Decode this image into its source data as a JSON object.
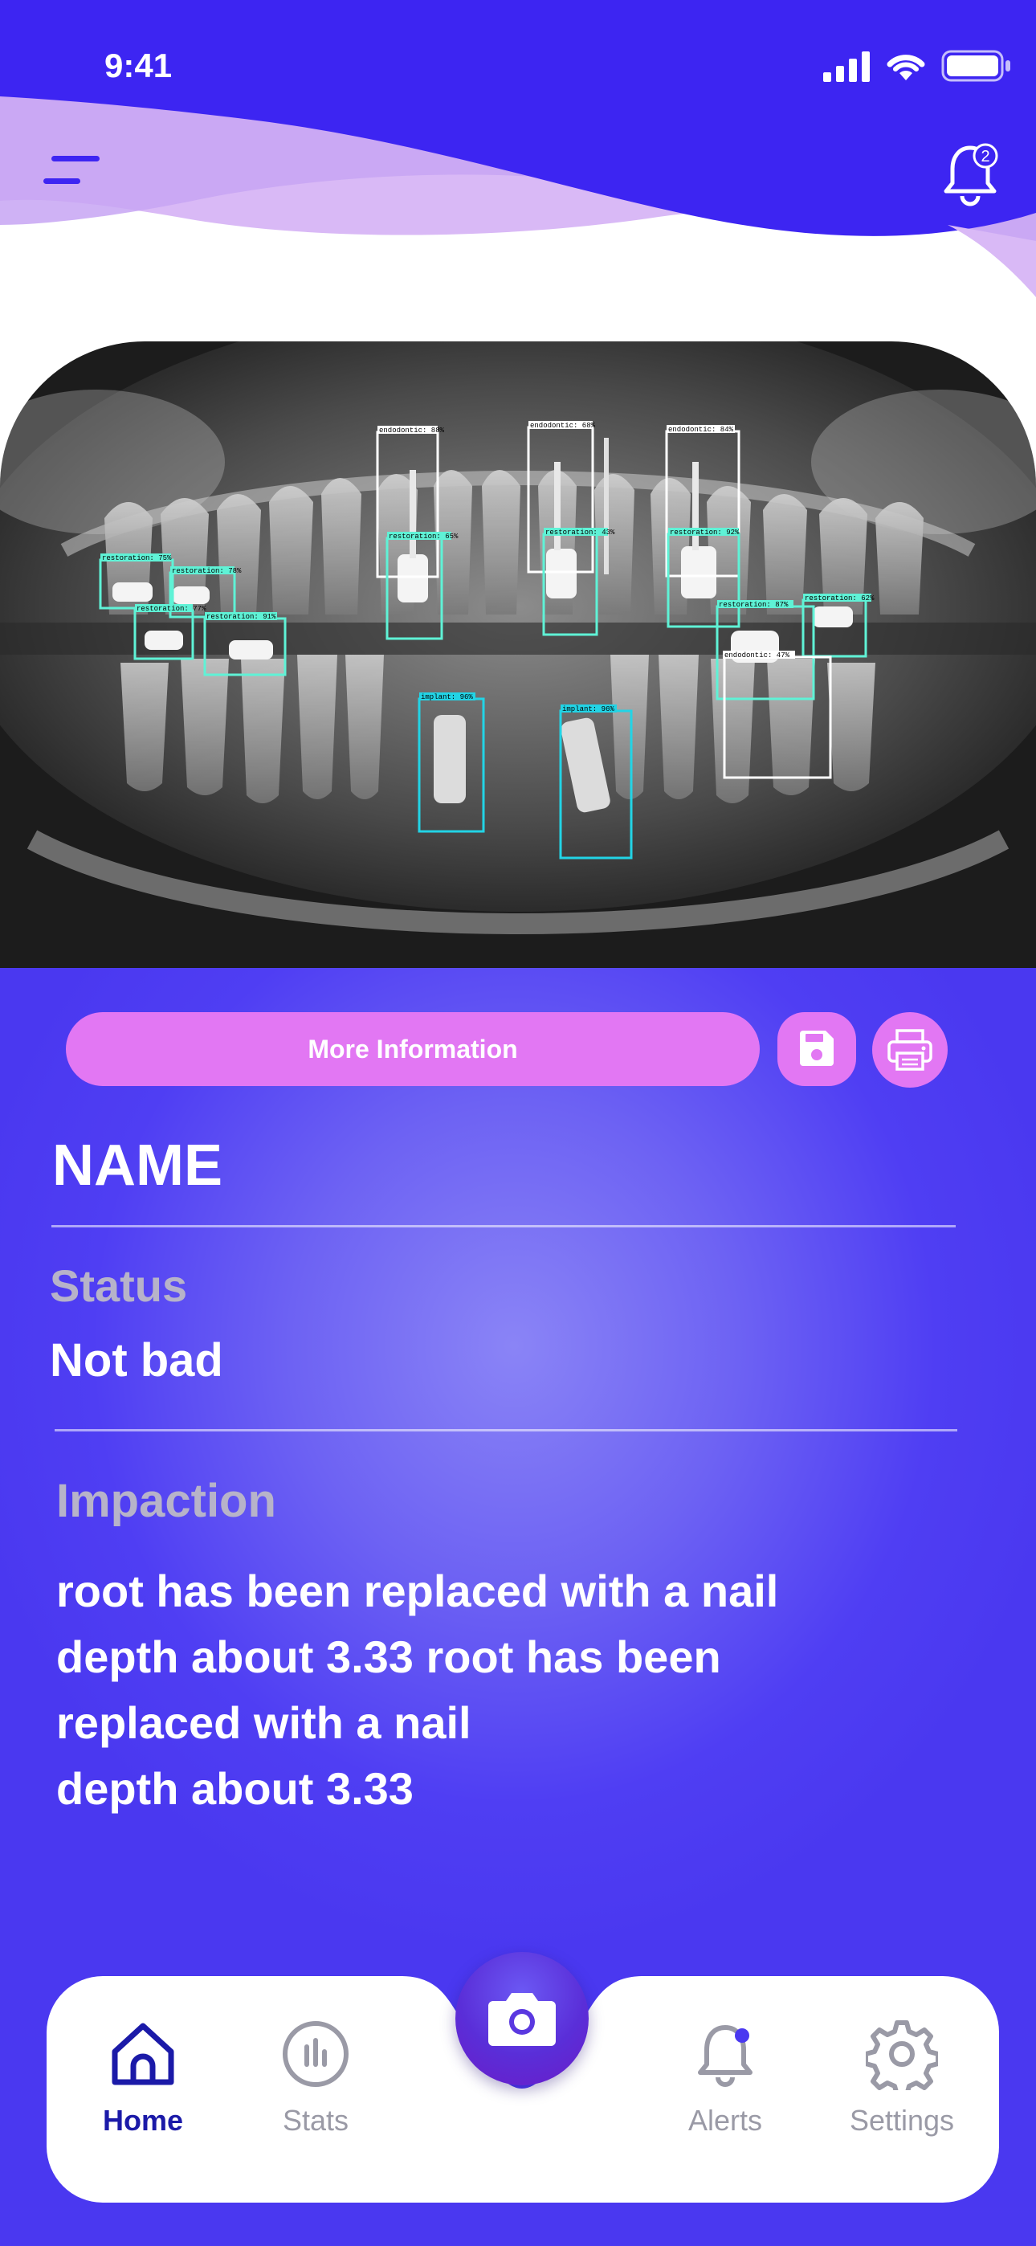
{
  "statusbar": {
    "time": "9:41"
  },
  "header": {
    "notification_count": "2"
  },
  "actions": {
    "more_info_label": "More Information"
  },
  "patient": {
    "name": "NAME",
    "status_label": "Status",
    "status_value": "Not bad",
    "impaction_label": "Impaction",
    "impaction_text": "root has been replaced with a nail\ndepth about 3.33  root has been\nreplaced with a nail\ndepth about 3.33"
  },
  "detections": [
    {
      "label": "restoration: 75%",
      "color": "#5ff2d6"
    },
    {
      "label": "restoration: 78%",
      "color": "#5ff2d6"
    },
    {
      "label": "restoration: 77%",
      "color": "#5ff2d6"
    },
    {
      "label": "restoration: 91%",
      "color": "#5ff2d6"
    },
    {
      "label": "endodontic: 88%",
      "color": "#ffffff"
    },
    {
      "label": "restoration: 65%",
      "color": "#5ff2d6"
    },
    {
      "label": "endodontic: 68%",
      "color": "#ffffff"
    },
    {
      "label": "restoration: 43%",
      "color": "#5ff2d6"
    },
    {
      "label": "endodontic: 84%",
      "color": "#ffffff"
    },
    {
      "label": "restoration: 92%",
      "color": "#5ff2d6"
    },
    {
      "label": "restoration: 87%",
      "color": "#5ff2d6"
    },
    {
      "label": "restoration: 62%",
      "color": "#5ff2d6"
    },
    {
      "label": "endodontic: 47%",
      "color": "#ffffff"
    },
    {
      "label": "implant: 96%",
      "color": "#22d4e6"
    },
    {
      "label": "implant: 96%",
      "color": "#22d4e6"
    }
  ],
  "nav": {
    "home": "Home",
    "stats": "Stats",
    "alerts": "Alerts",
    "settings": "Settings"
  },
  "colors": {
    "primary": "#4a38f0",
    "accent": "#e277f3",
    "nav_active": "#1b1aa8",
    "nav_inactive": "#9a9aa6"
  }
}
